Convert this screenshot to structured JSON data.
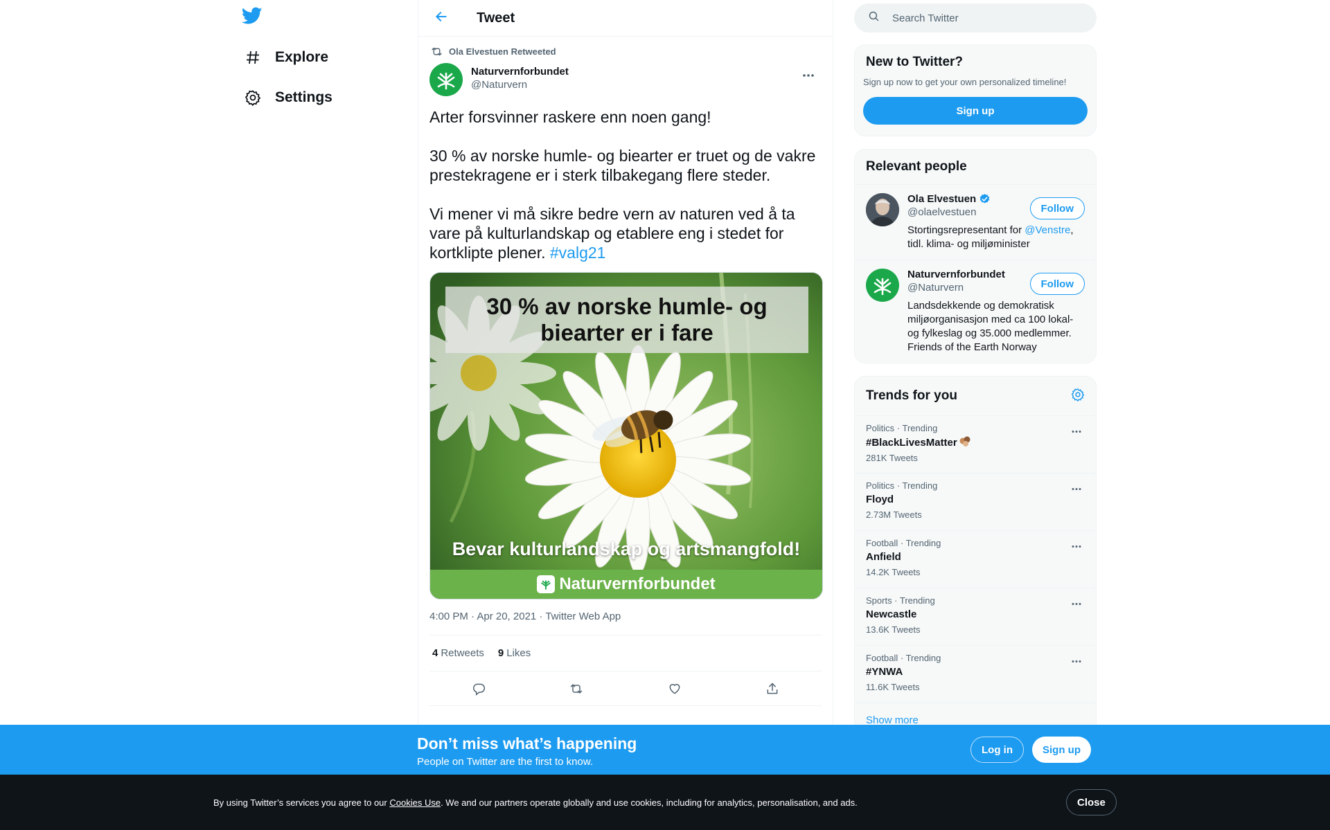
{
  "nav": {
    "logo_icon": "twitter-bird-icon",
    "items": [
      {
        "label": "Explore",
        "icon": "hashtag-icon"
      },
      {
        "label": "Settings",
        "icon": "gear-icon"
      }
    ]
  },
  "header": {
    "title": "Tweet",
    "back_icon": "arrow-left-icon"
  },
  "tweet": {
    "retweeted_by": "Ola Elvestuen Retweeted",
    "author_name": "Naturvernforbundet",
    "author_handle": "@Naturvern",
    "paragraphs": [
      "Arter forsvinner raskere enn noen gang!",
      "30 % av norske humle- og biearter er truet og de vakre prestekragene er i sterk tilbakegang flere steder.",
      "Vi mener vi må sikre bedre vern av naturen ved å ta vare på kulturlandskap og etablere eng i stedet for kortklipte plener."
    ],
    "hashtag": "#valg21",
    "media": {
      "headline": "30 % av norske humle- og biearter er i fare",
      "tagline": "Bevar kulturlandskap og artsmangfold!",
      "footer": "Naturvernforbundet"
    },
    "meta": "4:00 PM · Apr 20, 2021 · Twitter Web App",
    "retweets_count": "4",
    "retweets_label": "Retweets",
    "likes_count": "9",
    "likes_label": "Likes"
  },
  "search": {
    "placeholder": "Search Twitter"
  },
  "new_to_twitter": {
    "title": "New to Twitter?",
    "subtitle": "Sign up now to get your own personalized timeline!",
    "button": "Sign up"
  },
  "relevant_people": {
    "title": "Relevant people",
    "people": [
      {
        "name": "Ola Elvestuen",
        "verified": true,
        "handle": "@olaelvestuen",
        "bio_pre": "Stortingsrepresentant for ",
        "bio_link": "@Venstre",
        "bio_post": ", tidl. klima- og miljøminister",
        "follow": "Follow"
      },
      {
        "name": "Naturvernforbundet",
        "verified": false,
        "handle": "@Naturvern",
        "bio_pre": "Landsdekkende og demokratisk miljøorganisasjon med ca 100 lokal- og fylkeslag og 35.000 medlemmer. Friends of the Earth Norway",
        "bio_link": "",
        "bio_post": "",
        "follow": "Follow"
      }
    ]
  },
  "trends": {
    "title": "Trends for you",
    "items": [
      {
        "context": "Politics · Trending",
        "name": "#BlackLivesMatter",
        "count": "281K Tweets",
        "emoji": true
      },
      {
        "context": "Politics · Trending",
        "name": "Floyd",
        "count": "2.73M Tweets",
        "emoji": false
      },
      {
        "context": "Football · Trending",
        "name": "Anfield",
        "count": "14.2K Tweets",
        "emoji": false
      },
      {
        "context": "Sports · Trending",
        "name": "Newcastle",
        "count": "13.6K Tweets",
        "emoji": false
      },
      {
        "context": "Football · Trending",
        "name": "#YNWA",
        "count": "11.6K Tweets",
        "emoji": false
      }
    ],
    "show_more": "Show more"
  },
  "banner": {
    "title": "Don’t miss what’s happening",
    "subtitle": "People on Twitter are the first to know.",
    "login": "Log in",
    "signup": "Sign up"
  },
  "cookie": {
    "pre": "By using Twitter’s services you agree to our ",
    "link": "Cookies Use",
    "post": ". We and our partners operate globally and use cookies, including for analytics, personalisation, and ads.",
    "close": "Close"
  },
  "colors": {
    "accent": "#1d9bf0",
    "brand_green": "#1aa84a",
    "text": "#0f1419",
    "muted": "#536471"
  }
}
